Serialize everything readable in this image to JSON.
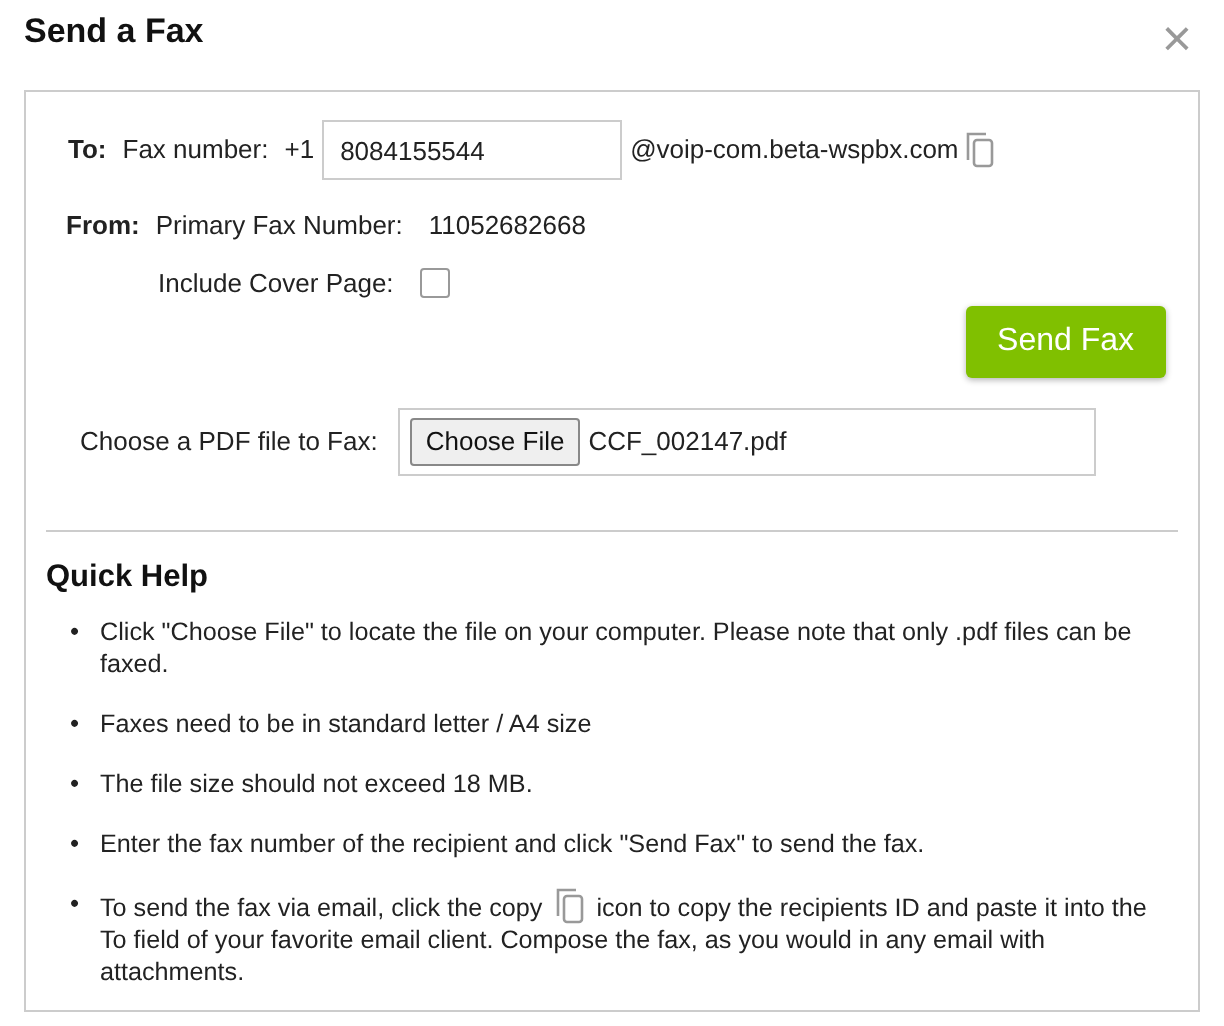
{
  "dialog": {
    "title": "Send a Fax",
    "close": "×"
  },
  "to": {
    "label": "To:",
    "field_label": "Fax number:",
    "prefix": "+1",
    "value": "8084155544",
    "domain": "@voip-com.beta-wspbx.com"
  },
  "from": {
    "label": "From:",
    "field_label": "Primary Fax Number:",
    "number": "11052682668"
  },
  "cover": {
    "label": "Include Cover Page:",
    "checked": false
  },
  "send_button": "Send Fax",
  "file": {
    "label": "Choose a PDF file to Fax:",
    "button": "Choose File",
    "filename": "CCF_002147.pdf"
  },
  "help": {
    "title": "Quick Help",
    "items": [
      {
        "kind": "text",
        "bullet": "•",
        "text": "Click \"Choose File\" to locate the file on your computer. Please note that only .pdf files can be faxed."
      },
      {
        "kind": "text",
        "bullet": "•",
        "text": "Faxes need to be in standard letter / A4 size"
      },
      {
        "kind": "text",
        "bullet": "•",
        "text": "The file size should not exceed 18 MB."
      },
      {
        "kind": "text",
        "bullet": "•",
        "text": "Enter the fax number of the recipient and click \"Send Fax\" to send the fax."
      },
      {
        "kind": "with-icon",
        "bullet": "•",
        "text": "To send the fax via email, click the copy",
        "text_after": "icon to copy the recipients ID and paste it into the To field of your favorite email client. Compose the fax, as you would in any email with attachments."
      }
    ]
  }
}
